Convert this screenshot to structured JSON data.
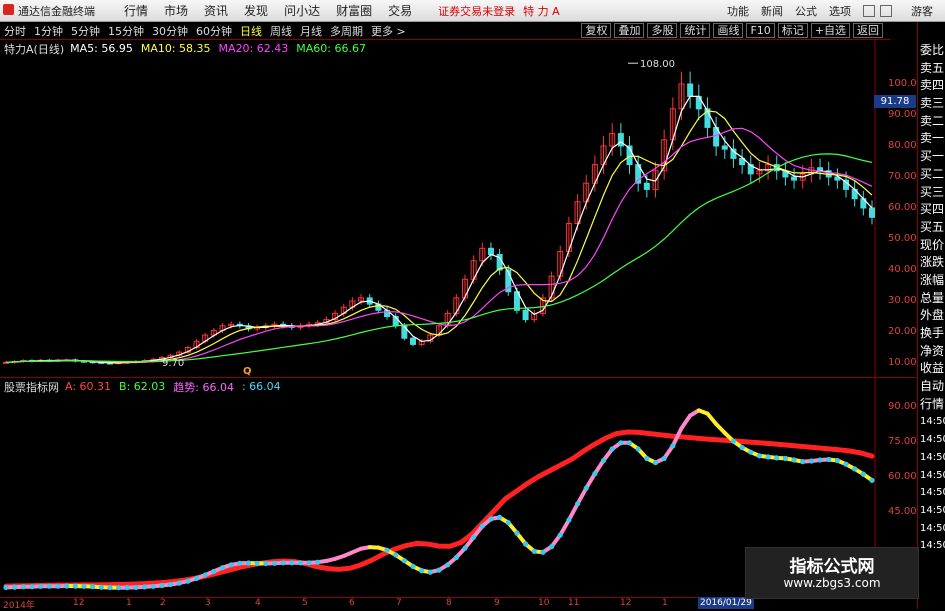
{
  "app": {
    "title": "通达信金融终端"
  },
  "menu": [
    "行情",
    "市场",
    "资讯",
    "发现",
    "问小达",
    "财富圈",
    "交易"
  ],
  "notice": {
    "text": "证券交易未登录",
    "stock": "特 力 A"
  },
  "topright": [
    "功能",
    "新闻",
    "公式",
    "选项"
  ],
  "guest": "游客",
  "periods": [
    "分时",
    "1分钟",
    "5分钟",
    "15分钟",
    "30分钟",
    "60分钟",
    "日线",
    "周线",
    "月线",
    "多周期",
    "更多 >"
  ],
  "active_period": "日线",
  "tools": [
    "复权",
    "叠加",
    "多股",
    "统计",
    "画线",
    "F10",
    "标记",
    "+自选",
    "返回"
  ],
  "main_legend": {
    "name": "特力A(日线)",
    "items": [
      {
        "text": "MA5: 56.95",
        "color": "#ffffff"
      },
      {
        "text": "MA10: 58.35",
        "color": "#ffff44"
      },
      {
        "text": "MA20: 62.43",
        "color": "#ff44ff"
      },
      {
        "text": "MA60: 66.67",
        "color": "#44ff44"
      }
    ]
  },
  "indicator_legend": {
    "name": "股票指标网",
    "items": [
      {
        "text": "A: 60.31",
        "color": "#ff4444"
      },
      {
        "text": "B: 62.03",
        "color": "#44ff44"
      },
      {
        "text": "趋势: 66.04",
        "color": "#ff66ff"
      },
      {
        "text": ": 66.04",
        "color": "#44ddff"
      }
    ]
  },
  "price_axis": [
    "100.0",
    "90.00",
    "80.00",
    "70.00",
    "60.00",
    "50.00",
    "40.00",
    "30.00",
    "20.00",
    "10.00"
  ],
  "indicator_axis": [
    "90.00",
    "75.00",
    "60.00",
    "45.00"
  ],
  "current_price_tag": "91.78",
  "annotations": {
    "high": "108.00",
    "low": "9.70",
    "marker": "Q"
  },
  "right_panel": [
    "委比",
    "卖五",
    "卖四",
    "卖三",
    "卖二",
    "卖一",
    "买一",
    "买二",
    "买三",
    "买四",
    "买五",
    "现价",
    "涨跌",
    "涨幅",
    "总量",
    "外盘",
    "换手",
    "净资",
    "收益",
    "自动",
    "行情",
    "14:50",
    "14:50",
    "14:50",
    "14:50",
    "14:50",
    "14:50",
    "14:50",
    "14:50"
  ],
  "xaxis": {
    "labels": [
      "2014年",
      "12",
      "1",
      "2",
      "3",
      "4",
      "5",
      "6",
      "7",
      "8",
      "9",
      "10",
      "11",
      "12",
      "1"
    ],
    "date_tag": "2016/01/29"
  },
  "watermark": {
    "title": "指标公式网",
    "url": "www.zbgs3.com"
  },
  "colors": {
    "up": "#ff3333",
    "down": "#44dddd",
    "ma5": "#ffffff",
    "ma10": "#ffff44",
    "ma20": "#ff44ff",
    "ma60": "#44ff44"
  },
  "chart_data": {
    "type": "line",
    "ylim": [
      9.7,
      108
    ],
    "close": [
      10.2,
      10.5,
      10.8,
      10.6,
      10.9,
      10.7,
      10.9,
      11.0,
      10.6,
      10.4,
      10.2,
      10.0,
      9.9,
      10.1,
      10.3,
      10.5,
      10.8,
      11.2,
      11.8,
      12.5,
      13.5,
      15.0,
      17.0,
      19.0,
      20.5,
      22.0,
      22.5,
      22.0,
      21.0,
      21.5,
      22.0,
      22.5,
      22.0,
      21.5,
      22.0,
      22.5,
      23.0,
      24.0,
      26.0,
      28.0,
      30.0,
      31.0,
      29.0,
      27.0,
      25.0,
      22.0,
      18.0,
      16.0,
      17.0,
      19.0,
      22.0,
      26.0,
      31.0,
      37.0,
      43.0,
      47.0,
      45.0,
      40.0,
      33.0,
      27.0,
      24.0,
      26.0,
      31.0,
      38.0,
      46.0,
      55.0,
      62.0,
      68.0,
      74.0,
      80.0,
      84.0,
      80.0,
      74.0,
      68.0,
      66.0,
      72.0,
      82.0,
      92.0,
      100.0,
      96.0,
      92.0,
      86.0,
      80.0,
      79.0,
      76.0,
      74.0,
      71.0,
      72.0,
      74.0,
      72.0,
      70.0,
      69.0,
      71.0,
      73.0,
      72.0,
      70.0,
      69.0,
      66.0,
      63.0,
      60.0,
      57.0
    ],
    "indicator": [
      1.0,
      1.1,
      1.2,
      1.3,
      1.4,
      1.5,
      1.5,
      1.6,
      1.6,
      1.7,
      1.8,
      1.9,
      2.1,
      2.4,
      2.8,
      3.3,
      4.0,
      5.0,
      6.2,
      7.6,
      9.0,
      10.5,
      11.8,
      12.8,
      13.5,
      13.9,
      13.6,
      12.5,
      11.0,
      10.0,
      9.6,
      10.2,
      12.0,
      14.5,
      17.5,
      20.0,
      21.8,
      23.0,
      22.6,
      21.6,
      21.5,
      23.5,
      28.0,
      34.0,
      40.0,
      46.0,
      50.0,
      54.0,
      57.5,
      60.5,
      63.5,
      66.5,
      70.5,
      74.0,
      77.2,
      79.6,
      80.4,
      80.2,
      79.6,
      78.9,
      78.3,
      77.8,
      77.3,
      76.8,
      76.4,
      76.0,
      75.6,
      75.2,
      74.8,
      74.3,
      73.8,
      73.3,
      72.8,
      72.3,
      71.8,
      71.3,
      70.6,
      69.6,
      68.0
    ]
  }
}
